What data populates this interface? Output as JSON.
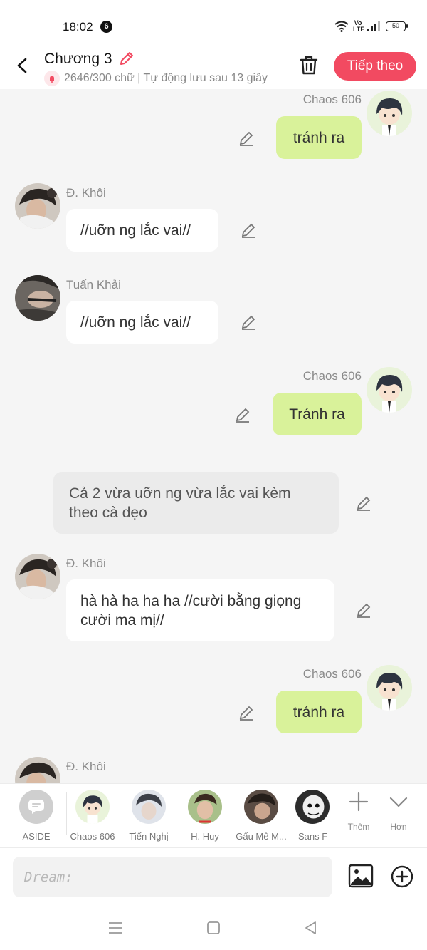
{
  "status_bar": {
    "time": "18:02",
    "notification_count": "6",
    "battery": "50",
    "network_label": "Vo LTE"
  },
  "header": {
    "title": "Chương 3",
    "subtitle": "2646/300 chữ | Tự động lưu sau 13 giây",
    "next_button": "Tiếp theo"
  },
  "messages": [
    {
      "sender": "Chaos 606",
      "text": "tránh ra",
      "side": "right"
    },
    {
      "sender": "Đ. Khôi",
      "text": "//uỡn ng lắc vai//",
      "side": "left"
    },
    {
      "sender": "Tuấn Khải",
      "text": "//uỡn ng lắc vai//",
      "side": "left"
    },
    {
      "sender": "Chaos 606",
      "text": "Tránh ra",
      "side": "right"
    },
    {
      "sender": "",
      "text": "Cả 2 vừa uỡn ng vừa lắc vai kèm theo cà dẹo",
      "side": "narration"
    },
    {
      "sender": "Đ. Khôi",
      "text": "hà hà ha ha ha //cười bằng giọng cười ma mị//",
      "side": "left"
    },
    {
      "sender": "Chaos 606",
      "text": "tránh ra",
      "side": "right"
    },
    {
      "sender": "Đ. Khôi",
      "text": "",
      "side": "left"
    }
  ],
  "characters": [
    {
      "name": "ASIDE"
    },
    {
      "name": "Chaos 606"
    },
    {
      "name": "Tiến Nghị"
    },
    {
      "name": "H. Huy"
    },
    {
      "name": "Gấu Mê M..."
    },
    {
      "name": "Sans F"
    }
  ],
  "tools": {
    "more": "Thêm",
    "collapse": "Hơn"
  },
  "input": {
    "placeholder": "Dream:"
  },
  "colors": {
    "accent": "#f24a61",
    "own_bubble": "#d9f29a",
    "other_bubble": "#ffffff",
    "narration_bubble": "#ebebeb"
  }
}
